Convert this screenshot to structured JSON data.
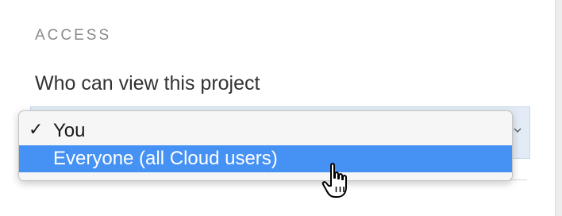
{
  "section": {
    "heading": "ACCESS"
  },
  "field": {
    "label": "Who can view this project"
  },
  "dropdown": {
    "selected_value": "You",
    "options": [
      {
        "label": "You",
        "checked": true,
        "highlighted": false
      },
      {
        "label": "Everyone (all Cloud users)",
        "checked": false,
        "highlighted": true
      }
    ],
    "check_symbol": "✓"
  },
  "icons": {
    "check": "checkmark-icon",
    "chevron": "chevron-down-icon",
    "cursor": "hand-pointer-cursor-icon"
  },
  "colors": {
    "highlight": "#4591f4",
    "select_bg": "#e3ecf6",
    "menu_bg": "#f6f6f6",
    "heading": "#8a8a8a",
    "label": "#333333"
  }
}
